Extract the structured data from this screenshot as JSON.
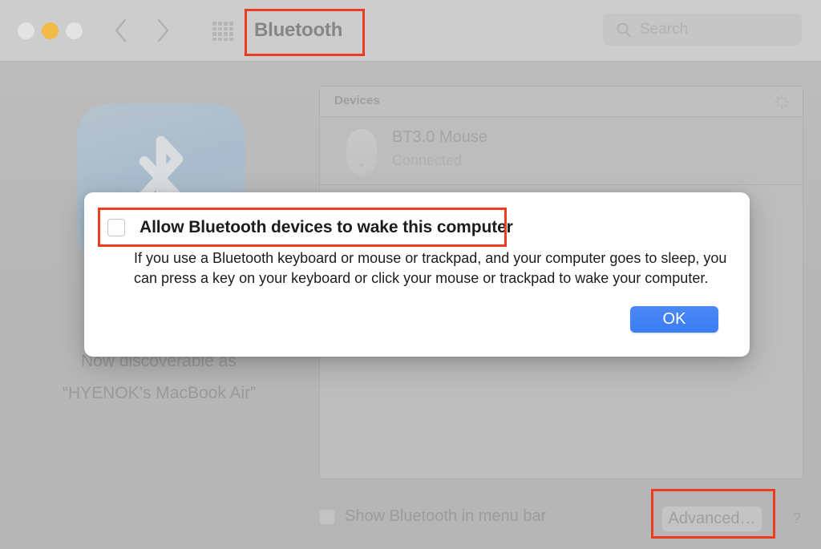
{
  "window": {
    "title": "Bluetooth",
    "traffic_lights": [
      "close-button",
      "minimize-button",
      "zoom-button"
    ],
    "nav": {
      "back": "back-chevron",
      "forward": "forward-chevron",
      "show_all": "grid-icon"
    },
    "search": {
      "placeholder": "Search",
      "value": "",
      "icon": "search-icon"
    }
  },
  "content": {
    "bluetooth_icon": "bluetooth-icon",
    "discoverable_line1": "Now discoverable as",
    "discoverable_line2": "“HYENOK’s MacBook Air”",
    "devices": {
      "header": "Devices",
      "spinner": "scanning-spinner-icon",
      "rows": [
        {
          "name": "BT3.0 Mouse",
          "status": "Connected",
          "icon": "mouse-icon"
        },
        {
          "name": "",
          "status": "",
          "icon": "device-icon"
        }
      ]
    },
    "bottom": {
      "show_in_menu_bar_label": "Show Bluetooth in menu bar",
      "show_in_menu_bar_checked": false,
      "advanced_label": "Advanced…",
      "help_label": "?"
    }
  },
  "dialog": {
    "checkbox_label": "Allow Bluetooth devices to wake this computer",
    "checkbox_checked": false,
    "description": "If you use a Bluetooth keyboard or mouse or trackpad, and your computer goes to sleep, you can press a key on your keyboard or click your mouse or trackpad to wake your computer.",
    "ok_label": "OK"
  },
  "annotations": {
    "color": "#F03C1E",
    "boxes": [
      "pane-title",
      "wake-checkbox-row",
      "advanced-button"
    ]
  },
  "colors": {
    "titlebar": "#CDCDCD",
    "content": "#B8B8B8",
    "accent_blue": "#3B7DF3",
    "annotation_red": "#F03C1E",
    "minimize_yellow": "#F2BB46"
  }
}
